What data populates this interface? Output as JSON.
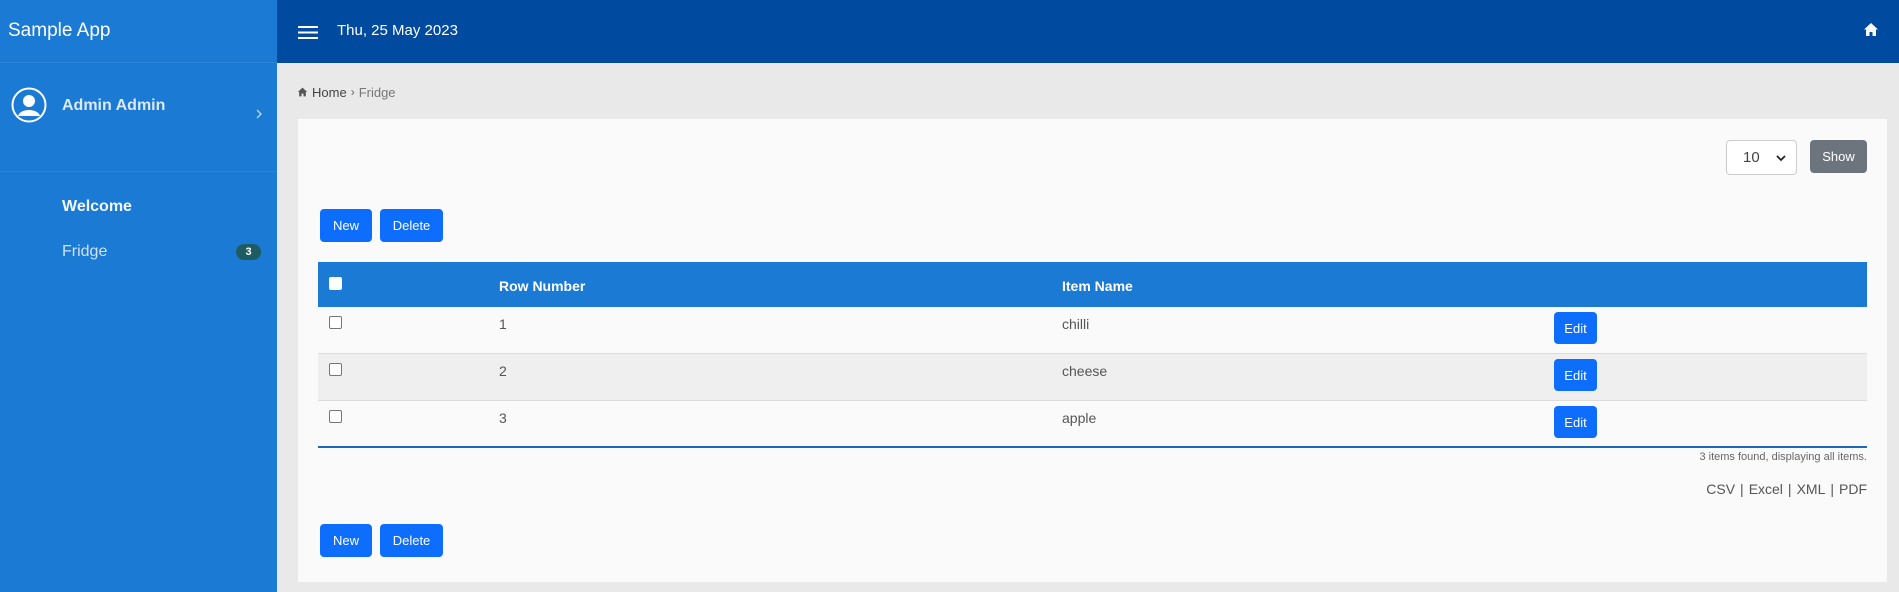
{
  "app": {
    "title": "Sample App"
  },
  "user": {
    "name": "Admin Admin"
  },
  "sidebar": {
    "items": [
      {
        "label": "Welcome"
      },
      {
        "label": "Fridge",
        "badge": "3"
      }
    ]
  },
  "header": {
    "date": "Thu, 25 May 2023"
  },
  "breadcrumb": {
    "home": "Home",
    "current": "Fridge"
  },
  "toolbar": {
    "page_size": "10",
    "show_label": "Show",
    "new_label": "New",
    "delete_label": "Delete"
  },
  "table": {
    "columns": [
      "",
      "Row Number",
      "Item Name",
      ""
    ],
    "rows": [
      {
        "row_number": "1",
        "item_name": "chilli",
        "action": "Edit"
      },
      {
        "row_number": "2",
        "item_name": "cheese",
        "action": "Edit"
      },
      {
        "row_number": "3",
        "item_name": "apple",
        "action": "Edit"
      }
    ],
    "summary": "3 items found, displaying all items."
  },
  "exports": [
    "CSV",
    "Excel",
    "XML",
    "PDF"
  ],
  "colors": {
    "sidebar": "#1a7ad4",
    "topbar": "#004a9f",
    "primary": "#0d6efd",
    "secondary": "#6c757d"
  }
}
